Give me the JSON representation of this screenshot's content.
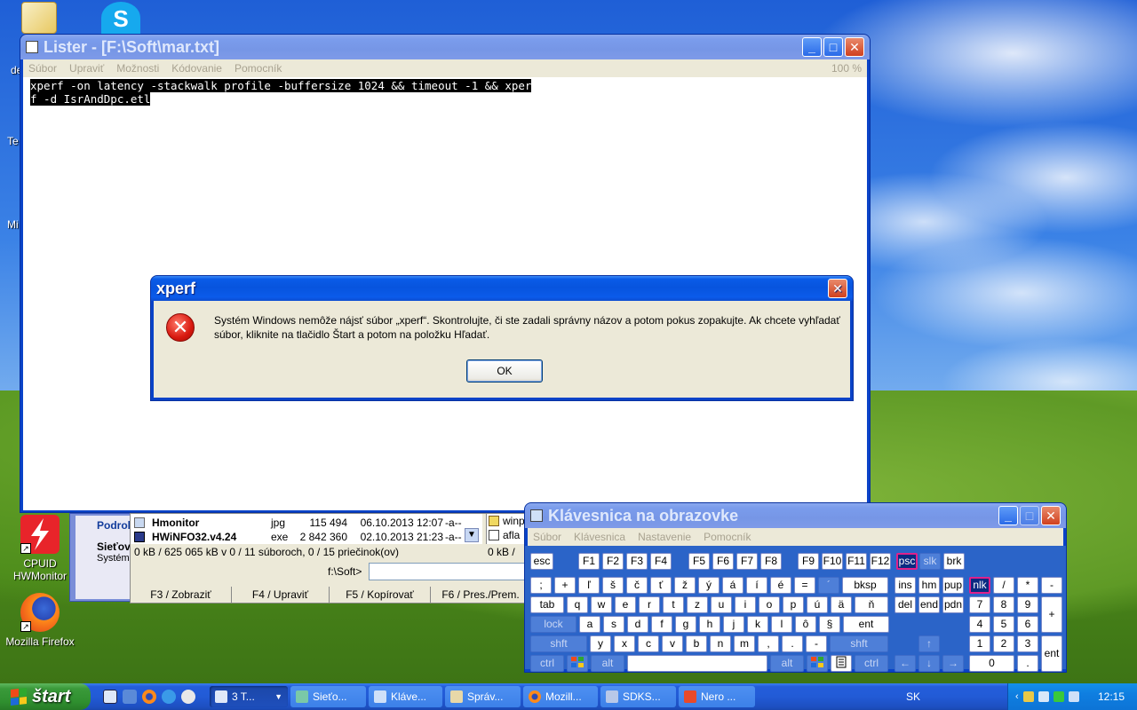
{
  "desktop": {
    "icons": [
      {
        "label": "CPUID HWMonitor",
        "line1": "CPUID",
        "line2": "HWMonitor"
      },
      {
        "label": "Mozilla Firefox"
      }
    ],
    "partial_labels": [
      "de",
      "Te",
      "Mi"
    ]
  },
  "lister": {
    "title": "Lister - [F:\\Soft\\mar.txt]",
    "menu": [
      "Súbor",
      "Upraviť",
      "Možnosti",
      "Kódovanie",
      "Pomocník"
    ],
    "zoom": "100 %",
    "lines": [
      "xperf -on latency -stackwalk profile -buffersize 1024 && timeout -1 && xper",
      "f -d IsrAndDpc.etl"
    ]
  },
  "dialog": {
    "title": "xperf",
    "message": "Systém Windows nemôže nájsť súbor „xperf“. Skontrolujte, či ste zadali správny názov a potom pokus zopakujte. Ak chcete vyhľadať súbor, kliknite na tlačidlo Štart a potom na položku Hľadať.",
    "ok_label": "OK"
  },
  "total_commander": {
    "left_panel": [
      "Podrob",
      "Sieťov",
      "Systém"
    ],
    "files": [
      {
        "name": "Hmonitor",
        "ext": "jpg",
        "size": "115 494",
        "date": "06.10.2013 12:07",
        "attr": "-a--"
      },
      {
        "name": "HWiNFO32.v4.24",
        "ext": "exe",
        "size": "2 842 360",
        "date": "02.10.2013 21:23",
        "attr": "-a--"
      }
    ],
    "right_files": [
      "winp",
      "afla"
    ],
    "status_left": "0 kB / 625 065 kB v 0 / 11 súboroch, 0 / 15 priečinok(ov)",
    "status_right": "0 kB /",
    "path": "f:\\Soft>",
    "fkeys": [
      "F3 / Zobraziť",
      "F4 / Upraviť",
      "F5 / Kopírovať",
      "F6 / Pres./Prem."
    ]
  },
  "osk": {
    "title": "Klávesnica na obrazovke",
    "menu": [
      "Súbor",
      "Klávesnica",
      "Nastavenie",
      "Pomocník"
    ],
    "row0": [
      "esc",
      "F1",
      "F2",
      "F3",
      "F4",
      "F5",
      "F6",
      "F7",
      "F8",
      "F9",
      "F10",
      "F11",
      "F12",
      "psc",
      "slk",
      "brk"
    ],
    "row1": [
      ";",
      "+",
      "ľ",
      "š",
      "č",
      "ť",
      "ž",
      "ý",
      "á",
      "í",
      "é",
      "=",
      "´",
      "bksp",
      "ins",
      "hm",
      "pup",
      "nlk",
      "/",
      "*",
      "-"
    ],
    "row2": [
      "tab",
      "q",
      "w",
      "e",
      "r",
      "t",
      "z",
      "u",
      "i",
      "o",
      "p",
      "ú",
      "ä",
      "ň",
      "del",
      "end",
      "pdn",
      "7",
      "8",
      "9",
      "+"
    ],
    "row3": [
      "lock",
      "a",
      "s",
      "d",
      "f",
      "g",
      "h",
      "j",
      "k",
      "l",
      "ô",
      "§",
      "ent",
      "4",
      "5",
      "6"
    ],
    "row4": [
      "shft",
      "y",
      "x",
      "c",
      "v",
      "b",
      "n",
      "m",
      ",",
      ".",
      "-",
      "shft",
      "↑",
      "1",
      "2",
      "3",
      "ent"
    ],
    "row5": [
      "ctrl",
      "alt",
      "alt",
      "ctrl",
      "←",
      "↓",
      "→",
      "0",
      "."
    ]
  },
  "taskbar": {
    "start_label": "štart",
    "tasks": [
      {
        "label": "3 T...",
        "active": true
      },
      {
        "label": "Sieťo..."
      },
      {
        "label": "Kláve..."
      },
      {
        "label": "Správ..."
      },
      {
        "label": "Mozill..."
      },
      {
        "label": "SDKS..."
      },
      {
        "label": "Nero ..."
      }
    ],
    "language": "SK",
    "clock": "12:15"
  }
}
